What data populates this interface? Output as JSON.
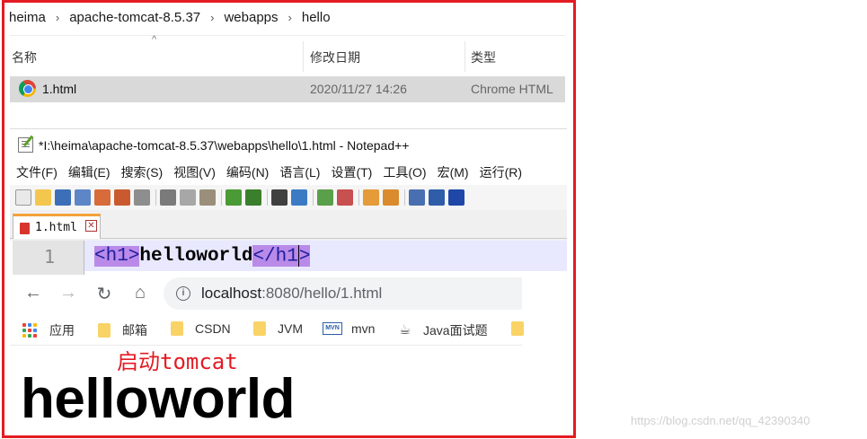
{
  "explorer": {
    "breadcrumb": [
      "heima",
      "apache-tomcat-8.5.37",
      "webapps",
      "hello"
    ],
    "breadcrumb_sep": "›",
    "sort_indicator": "^",
    "columns": {
      "name": "名称",
      "modified": "修改日期",
      "type": "类型"
    },
    "file": {
      "name": "1.html",
      "modified": "2020/11/27 14:26",
      "type": "Chrome HTML"
    }
  },
  "notepad": {
    "title": "*I:\\heima\\apache-tomcat-8.5.37\\webapps\\hello\\1.html - Notepad++",
    "menu": [
      "文件(F)",
      "编辑(E)",
      "搜索(S)",
      "视图(V)",
      "编码(N)",
      "语言(L)",
      "设置(T)",
      "工具(O)",
      "宏(M)",
      "运行(R)"
    ],
    "tab": {
      "label": "1.html",
      "close": "✕"
    },
    "line_number": "1",
    "code": {
      "open_tag": "<h1>",
      "text": "helloworld",
      "close_tag_a": "</h1",
      "close_tag_b": ">"
    }
  },
  "browser": {
    "back": "←",
    "forward": "→",
    "reload": "↻",
    "home": "⌂",
    "info_icon": "i",
    "url_host": "localhost",
    "url_path": ":8080/hello/1.html",
    "bookmarks": {
      "apps": "应用",
      "b1": "邮箱",
      "b2": "CSDN",
      "b3": "JVM",
      "b4": "mvn",
      "b5": "Java面试题"
    },
    "mvn_icon_text": "MVN",
    "annotation": "启动tomcat",
    "page_heading": "helloworld"
  },
  "watermark": "https://blog.csdn.net/qq_42390340",
  "colors": {
    "frame": "#e41b23",
    "tag_highlight": "#b98ae8",
    "line_highlight": "#e8e8ff",
    "selected_row": "#d9d9d9"
  }
}
